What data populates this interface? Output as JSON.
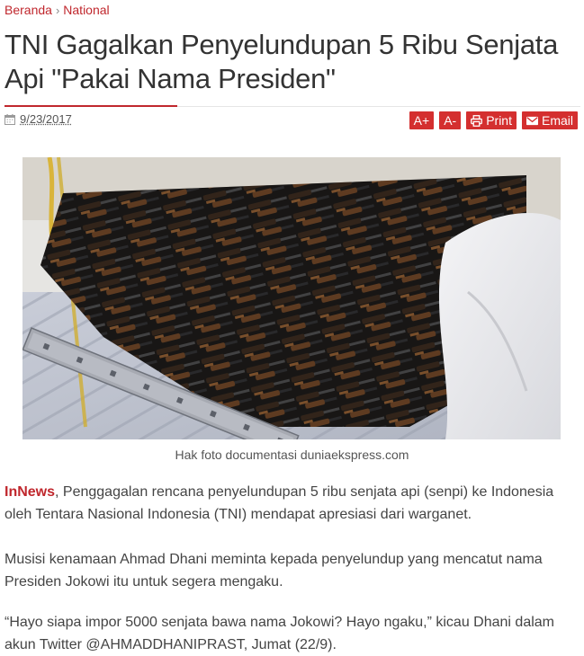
{
  "breadcrumb": {
    "home": "Beranda",
    "separator": "›",
    "section": "National"
  },
  "article": {
    "title": "TNI Gagalkan Penyelundupan 5 Ribu Senjata Api \"Pakai Nama Presiden\"",
    "date": "9/23/2017",
    "date_icon": "calendar-icon"
  },
  "toolbar": {
    "font_increase": "A+",
    "font_decrease": "A-",
    "print_label": "Print",
    "print_icon": "printer-icon",
    "email_label": "Email",
    "email_icon": "envelope-icon"
  },
  "image": {
    "caption": "Hak foto documentasi duniaekspress.com"
  },
  "body": {
    "p1_source": "InNews",
    "p1_text": ", Penggagalan rencana penyelundupan 5 ribu senjata api (senpi) ke Indonesia oleh Tentara Nasional Indonesia (TNI) mendapat apresiasi dari warganet.",
    "p2_text": "Musisi kenamaan Ahmad Dhani meminta kepada penyelundup yang mencatut nama Presiden Jokowi itu untuk segera mengaku.",
    "p3_text": "“Hayo siapa impor 5000 senjata bawa nama Jokowi? Hayo ngaku,” kicau Dhani dalam akun Twitter @AHMADDHANIPRAST, Jumat (22/9)."
  },
  "colors": {
    "accent": "#c0272d",
    "button": "#d42f2f"
  }
}
